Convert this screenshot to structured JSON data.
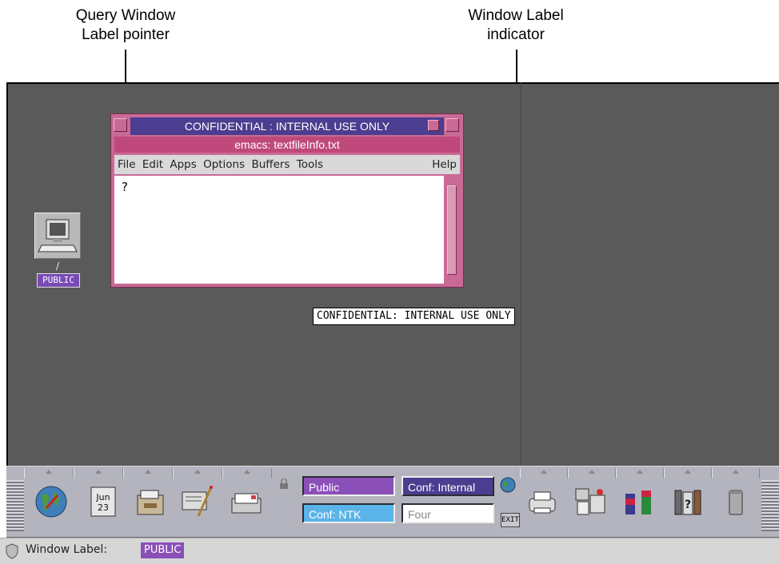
{
  "callouts": {
    "query_pointer": {
      "line1": "Query Window",
      "line2": "Label pointer"
    },
    "label_indicator": {
      "line1": "Window Label",
      "line2": "indicator"
    }
  },
  "desktop_icon": {
    "path": "/",
    "label": "PUBLIC"
  },
  "emacs_window": {
    "label_bar": "CONFIDENTIAL : INTERNAL USE ONLY",
    "title": "emacs: textfileInfo.txt",
    "menu": [
      "File",
      "Edit",
      "Apps",
      "Options",
      "Buffers",
      "Tools"
    ],
    "help": "Help",
    "cursor_glyph": "?"
  },
  "label_indicator": "CONFIDENTIAL: INTERNAL USE ONLY",
  "front_panel": {
    "calendar": {
      "month": "Jun",
      "day": "23"
    },
    "workspaces": {
      "public": "Public",
      "internal": "Conf: Internal",
      "ntk": "Conf: NTK",
      "four": "Four"
    },
    "exit_label": "EXIT",
    "colors": {
      "public": "#8a50b8",
      "internal": "#4b3d8f",
      "ntk": "#5ab4e8",
      "four": "#ffffff"
    }
  },
  "status_bar": {
    "label": "Window Label:",
    "value": "PUBLIC"
  }
}
